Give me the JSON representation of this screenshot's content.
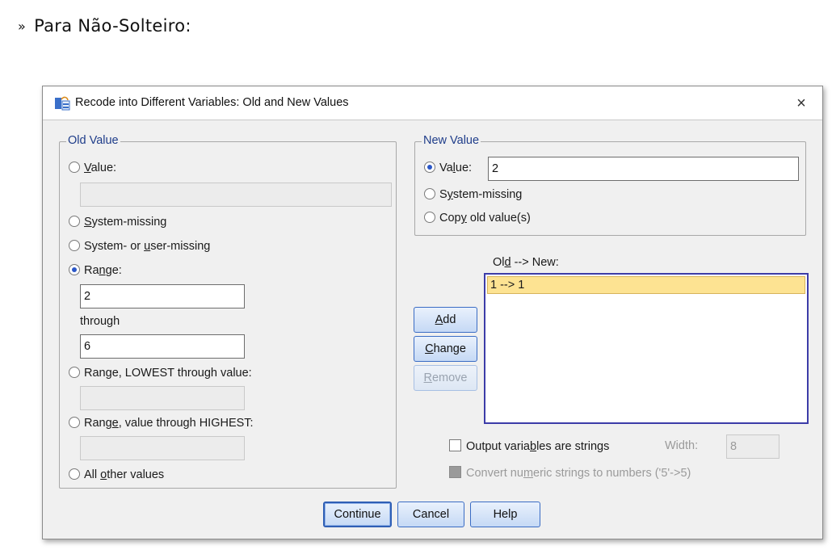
{
  "slide": {
    "bullet": "»",
    "heading": "Para Não-Solteiro:"
  },
  "window": {
    "title": "Recode into Different Variables: Old and New Values",
    "close": "×"
  },
  "old_value": {
    "legend": "Old Value",
    "value": {
      "pre": "",
      "u": "V",
      "post": "alue:",
      "input": ""
    },
    "system_missing": {
      "pre": "",
      "u": "S",
      "post": "ystem-missing"
    },
    "system_or_user": {
      "pre": "System- or ",
      "u": "u",
      "post": "ser-missing"
    },
    "range": {
      "pre": "Ra",
      "u": "n",
      "post": "ge:",
      "from": "2",
      "through_label": "through",
      "to": "6"
    },
    "range_lowest": {
      "pre": "Ran",
      "u": "g",
      "post": "e, LOWEST through value:",
      "input": ""
    },
    "range_highest": {
      "pre": "Rang",
      "u": "e",
      "post": ", value through HIGHEST:",
      "input": ""
    },
    "all_other": {
      "pre": "All ",
      "u": "o",
      "post": "ther values"
    },
    "selected": "range"
  },
  "new_value": {
    "legend": "New Value",
    "value": {
      "pre": "Va",
      "u": "l",
      "post": "ue:",
      "input": "2"
    },
    "system_missing": {
      "pre": "S",
      "u": "y",
      "post": "stem-missing"
    },
    "copy_old": {
      "pre": "Cop",
      "u": "y",
      "post": " old value(s)"
    },
    "selected": "value"
  },
  "mapping": {
    "label": {
      "pre": "Ol",
      "u": "d",
      "post": " --> New:"
    },
    "items": [
      "1 --> 1"
    ]
  },
  "actions": {
    "add": {
      "pre": "",
      "u": "A",
      "post": "dd"
    },
    "change": {
      "pre": "",
      "u": "C",
      "post": "hange"
    },
    "remove": {
      "pre": "",
      "u": "R",
      "post": "emove"
    }
  },
  "options": {
    "output_strings": {
      "pre": "Output varia",
      "u": "b",
      "post": "les are strings"
    },
    "width_label": "Width:",
    "width_value": "8",
    "convert_numeric": {
      "pre": "Convert nu",
      "u": "m",
      "post": "eric strings to numbers ('5'->5)"
    }
  },
  "footer": {
    "continue": "Continue",
    "cancel": "Cancel",
    "help": "Help"
  }
}
